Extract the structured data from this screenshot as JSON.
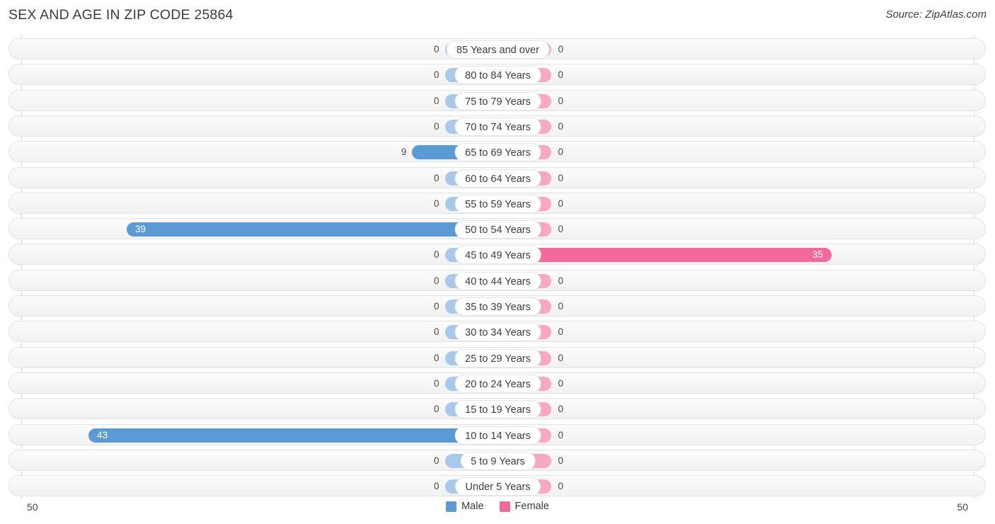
{
  "header": {
    "title": "SEX AND AGE IN ZIP CODE 25864",
    "source": "Source: ZipAtlas.com"
  },
  "legend": {
    "male_label": "Male",
    "female_label": "Female",
    "male_color": "#5b9bd5",
    "female_color": "#f4699b"
  },
  "axis": {
    "left_tick": "50",
    "right_tick": "50"
  },
  "chart_data": {
    "type": "bar",
    "subtype": "population-pyramid",
    "title": "SEX AND AGE IN ZIP CODE 25864",
    "xlabel": "",
    "ylabel": "",
    "xlim": [
      -50,
      50
    ],
    "axis_max": 50,
    "grid": false,
    "legend_position": "bottom-center",
    "categories": [
      "85 Years and over",
      "80 to 84 Years",
      "75 to 79 Years",
      "70 to 74 Years",
      "65 to 69 Years",
      "60 to 64 Years",
      "55 to 59 Years",
      "50 to 54 Years",
      "45 to 49 Years",
      "40 to 44 Years",
      "35 to 39 Years",
      "30 to 34 Years",
      "25 to 29 Years",
      "20 to 24 Years",
      "15 to 19 Years",
      "10 to 14 Years",
      "5 to 9 Years",
      "Under 5 Years"
    ],
    "series": [
      {
        "name": "Male",
        "color": "#5b9bd5",
        "values": [
          0,
          0,
          0,
          0,
          9,
          0,
          0,
          39,
          0,
          0,
          0,
          0,
          0,
          0,
          0,
          43,
          0,
          0
        ]
      },
      {
        "name": "Female",
        "color": "#f4699b",
        "values": [
          0,
          0,
          0,
          0,
          0,
          0,
          0,
          0,
          35,
          0,
          0,
          0,
          0,
          0,
          0,
          0,
          0,
          0
        ]
      }
    ]
  }
}
